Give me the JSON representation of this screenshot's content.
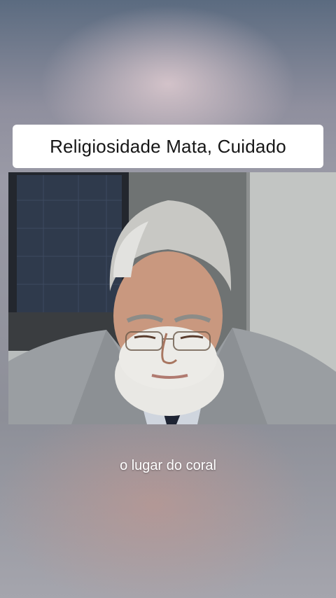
{
  "overlay": {
    "title": "Religiosidade Mata, Cuidado",
    "subtitle": "o lugar do coral"
  },
  "video": {
    "scene": "elderly man with grey hair, white beard and glasses in a grey suit, looking down, in front of a dark window and light stone wall"
  },
  "colors": {
    "title_background": "#ffffff",
    "title_text": "#161616",
    "subtitle_text": "#ffffff"
  }
}
